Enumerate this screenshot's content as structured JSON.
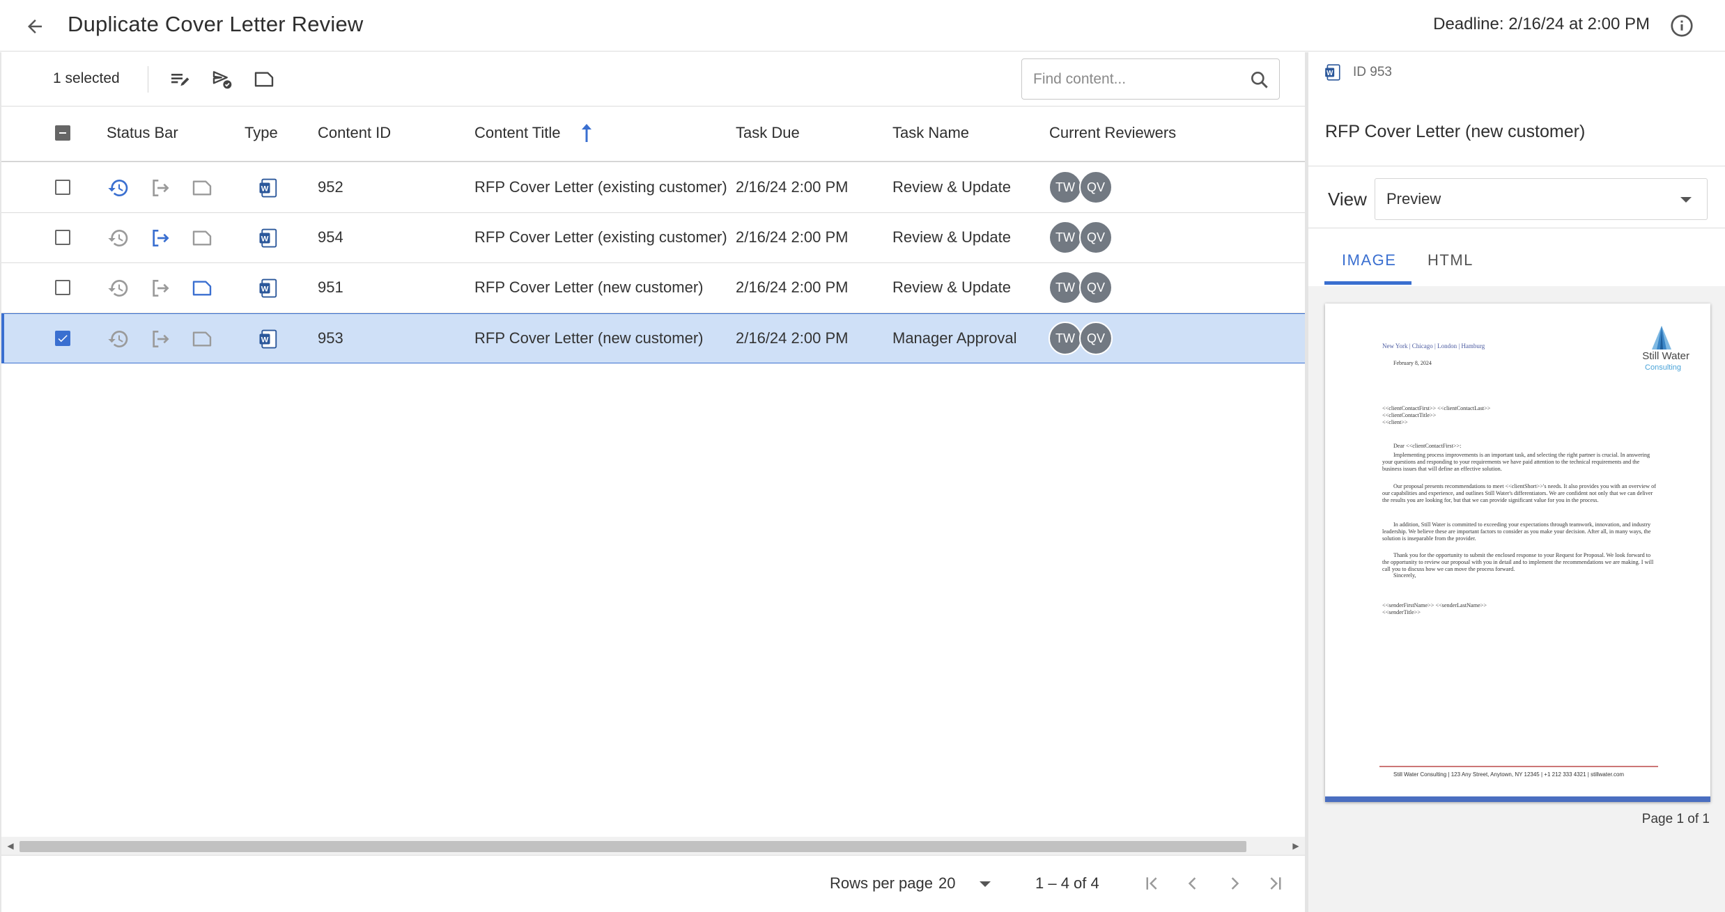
{
  "header": {
    "title": "Duplicate Cover Letter Review",
    "deadline": "Deadline: 2/16/24 at 2:00 PM"
  },
  "toolbar": {
    "selected_count": "1 selected",
    "search_placeholder": "Find content..."
  },
  "table": {
    "columns": {
      "status_bar": "Status Bar",
      "type": "Type",
      "content_id": "Content ID",
      "content_title": "Content Title",
      "task_due": "Task Due",
      "task_name": "Task Name",
      "current_reviewers": "Current Reviewers"
    },
    "sort_column": "content_title",
    "sort_direction": "ascending",
    "rows": [
      {
        "id": "952",
        "title": "RFP Cover Letter (existing customer)",
        "due": "2/16/24 2:00 PM",
        "task": "Review & Update",
        "reviewers": [
          "TW",
          "QV"
        ],
        "selected": false,
        "status_active": "history"
      },
      {
        "id": "954",
        "title": "RFP Cover Letter (existing customer)",
        "due": "2/16/24 2:00 PM",
        "task": "Review & Update",
        "reviewers": [
          "TW",
          "QV"
        ],
        "selected": false,
        "status_active": "export"
      },
      {
        "id": "951",
        "title": "RFP Cover Letter (new customer)",
        "due": "2/16/24 2:00 PM",
        "task": "Review & Update",
        "reviewers": [
          "TW",
          "QV"
        ],
        "selected": false,
        "status_active": "label"
      },
      {
        "id": "953",
        "title": "RFP Cover Letter (new customer)",
        "due": "2/16/24 2:00 PM",
        "task": "Manager Approval",
        "reviewers": [
          "TW",
          "QV"
        ],
        "selected": true,
        "status_active": "none"
      }
    ]
  },
  "pager": {
    "rows_per_page_label": "Rows per page",
    "rows_per_page": "20",
    "range": "1 – 4 of 4"
  },
  "detail": {
    "doc_id": "ID 953",
    "doc_title": "RFP Cover Letter (new customer)",
    "view_label": "View",
    "view_value": "Preview",
    "tabs": [
      "IMAGE",
      "HTML"
    ],
    "active_tab": "IMAGE",
    "page_indicator": "Page 1 of 1"
  },
  "letter": {
    "cities": "New York | Chicago | London | Hamburg",
    "date": "February 8, 2024",
    "logo_name": "Still Water",
    "logo_sub": "Consulting",
    "address": "<<clientContactFirst>> <<clientContactLast>>\n<<clientContactTitle>>\n<<client>>",
    "salutation": "Dear <<clientContactFirst>>:",
    "p1": "Implementing process improvements is an important task, and selecting the right partner is crucial. In answering your questions and responding to your requirements we have paid attention to the technical requirements and the business issues that will define an effective solution.",
    "p2": "Our proposal presents recommendations to meet <<clientShort>>'s needs. It also provides you with an overview of our capabilities and experience, and outlines Still Water's differentiators. We are confident not only that we can deliver the results you are looking for, but that we can provide significant value for you in the process.",
    "p3": "In addition, Still Water is committed to exceeding your expectations through teamwork, innovation, and industry leadership. We believe these are important factors to consider as you make your decision. After all, in many ways, the solution is inseparable from the provider.",
    "p4": "Thank you for the opportunity to submit the enclosed response to your Request for Proposal. We look forward to the opportunity to review our proposal with you in detail and to implement the recommendations we are making. I will call you to discuss how we can move the process forward.",
    "closing": "Sincerely,",
    "sender": "<<senderFirstName>> <<senderLastName>>\n<<senderTitle>>",
    "footer": "Still Water Consulting | 123 Any Street, Anytown, NY 12345 | +1 212 333 4321 | stillwater.com"
  },
  "colors": {
    "accent": "#3a6fd0",
    "selected_row": "#cfe0f7",
    "avatar": "#727982",
    "icon_inactive": "#9a9a9a"
  }
}
